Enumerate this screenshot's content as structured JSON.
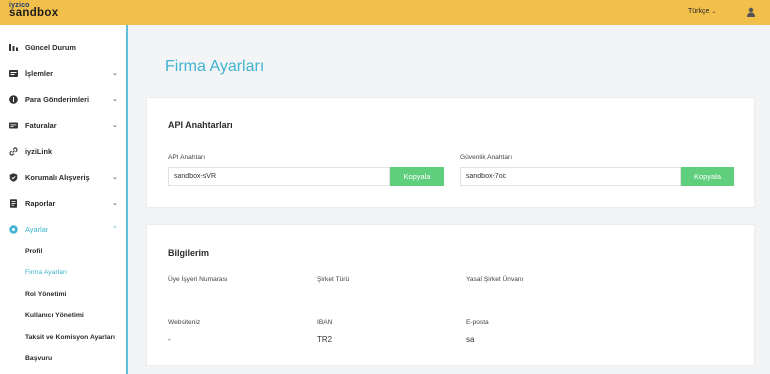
{
  "header": {
    "logo_small": "iyzico",
    "logo_big": "sandbox",
    "language": "Türkçe",
    "language_chevron": "⌄",
    "user_icon": "user-icon",
    "bar_color": "#f2bf4a"
  },
  "sidebar": {
    "items": [
      {
        "label": "Güncel Durum",
        "icon": "chart-bar-icon"
      },
      {
        "label": "İşlemler",
        "icon": "list-icon",
        "arrow": "⌄"
      },
      {
        "label": "Para Gönderimleri",
        "icon": "money-circle-icon",
        "arrow": "⌄"
      },
      {
        "label": "Faturalar",
        "icon": "invoice-icon",
        "arrow": "⌄"
      },
      {
        "label": "iyziLink",
        "icon": "link-icon"
      },
      {
        "label": "Korumalı Alışveriş",
        "icon": "shield-icon",
        "arrow": "⌄"
      },
      {
        "label": "Raporlar",
        "icon": "report-icon",
        "arrow": "⌄"
      },
      {
        "label": "Ayarlar",
        "icon": "gear-icon",
        "arrow": "⌃"
      }
    ],
    "sub_items": [
      {
        "label": "Profil"
      },
      {
        "label": "Firma Ayarları"
      },
      {
        "label": "Rol Yönetimi"
      },
      {
        "label": "Kullanıcı Yönetimi"
      },
      {
        "label": "Taksit ve Komisyon Ayarları"
      },
      {
        "label": "Başvuru"
      }
    ],
    "accent_color": "#3fb3cf"
  },
  "main": {
    "title": "Firma Ayarları",
    "api_card": {
      "title": "API Anahtarları",
      "api_key_label": "API Anahtarı",
      "api_key_value": "sandbox-sVR",
      "secret_key_label": "Güvenlik Anahtarı",
      "secret_key_value": "sandbox-7oc",
      "copy_label": "Kopyala",
      "copy_color": "#5fcf7d"
    },
    "info_card": {
      "title": "Bilgilerim",
      "fields": [
        {
          "label": "Üye İşyeri Numarası",
          "value": ""
        },
        {
          "label": "Şirket Türü",
          "value": ""
        },
        {
          "label": "Yasal Şirket Ünvanı",
          "value": ""
        },
        {
          "label": "Websiteniz",
          "value": "-"
        },
        {
          "label": "IBAN",
          "value": "TR2"
        },
        {
          "label": "E-posta",
          "value": "sa"
        }
      ]
    }
  }
}
